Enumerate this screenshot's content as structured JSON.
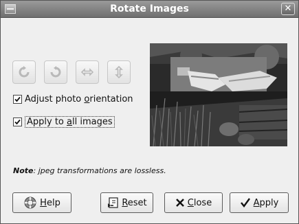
{
  "window": {
    "title": "Rotate Images",
    "close_glyph": "✕"
  },
  "toolbar": {
    "buttons": [
      {
        "icon": "rotate-right-icon",
        "enabled": false
      },
      {
        "icon": "rotate-left-icon",
        "enabled": false
      },
      {
        "icon": "flip-horizontal-icon",
        "enabled": false
      },
      {
        "icon": "flip-vertical-icon",
        "enabled": false
      }
    ]
  },
  "options": {
    "adjust_orientation": {
      "label_pre": "Adjust photo ",
      "label_mnemonic": "o",
      "label_post": "rientation",
      "checked": true
    },
    "apply_all": {
      "label_pre": "Apply to ",
      "label_mnemonic": "a",
      "label_post": "ll images",
      "checked": true
    }
  },
  "note": {
    "bold": "Note",
    "text": ": jpeg transformations are lossless."
  },
  "buttons": {
    "help": {
      "mnemonic": "H",
      "rest": "elp"
    },
    "reset": {
      "mnemonic": "R",
      "rest": "eset"
    },
    "close": {
      "mnemonic": "C",
      "rest": "lose"
    },
    "apply": {
      "mnemonic": "A",
      "rest": "pply"
    }
  },
  "colors": {
    "titlebar": "#7a7a7a",
    "dialog_bg": "#efefef"
  }
}
